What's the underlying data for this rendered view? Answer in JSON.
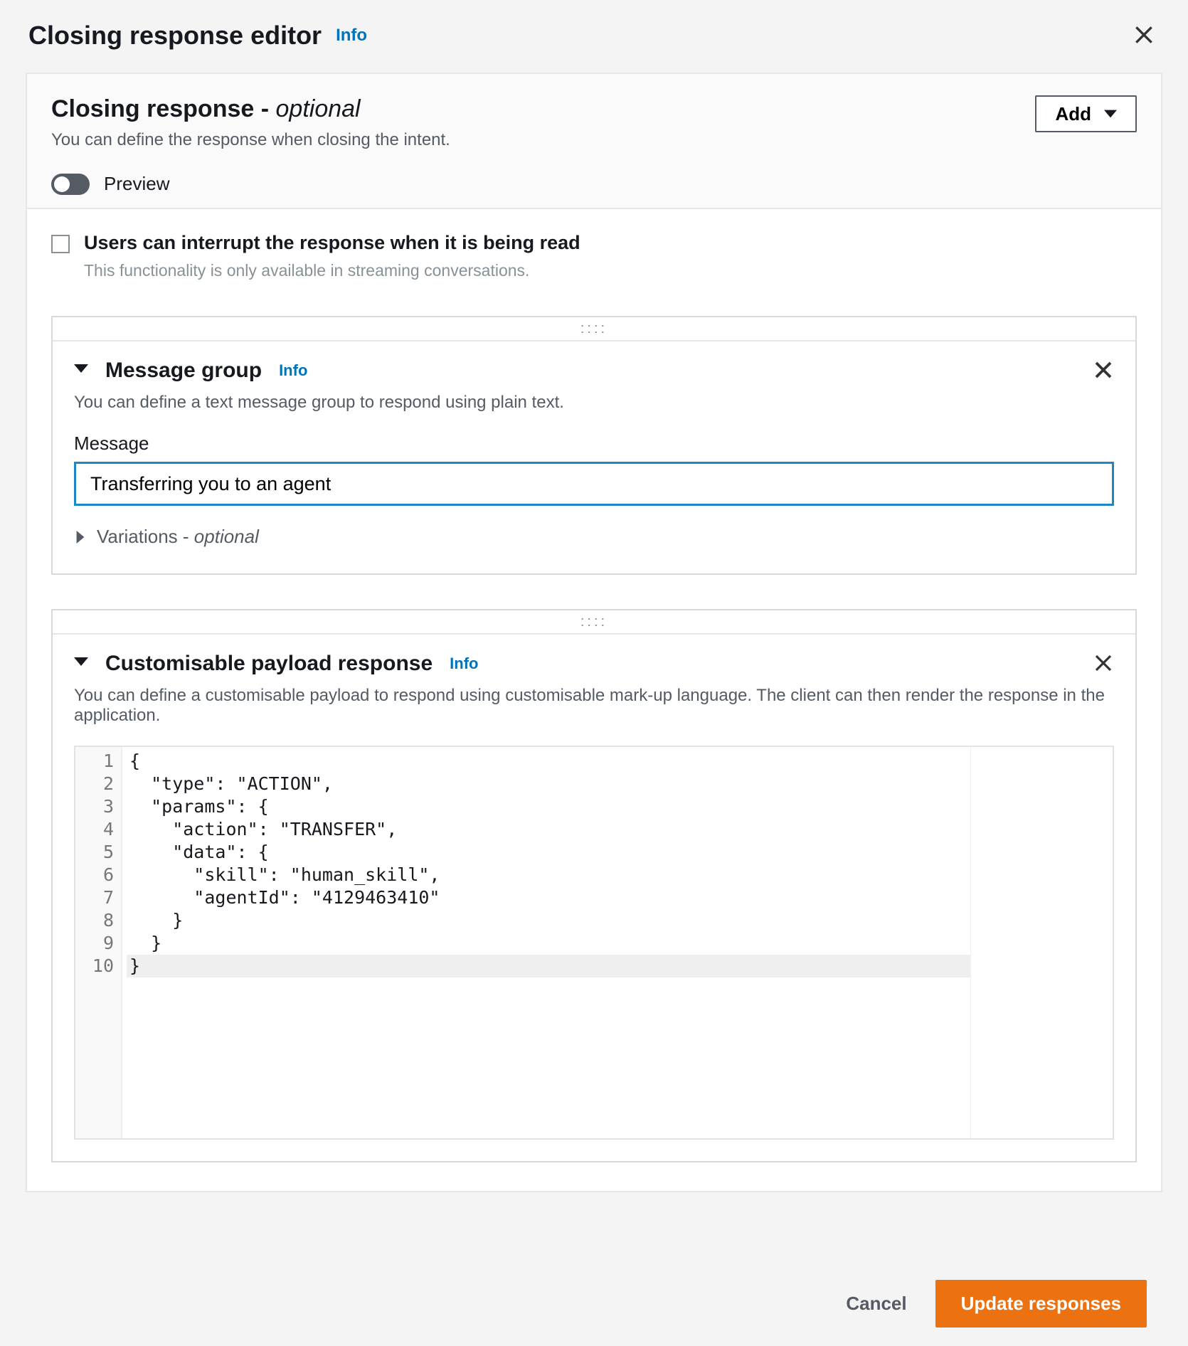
{
  "modal": {
    "title": "Closing response editor",
    "info_label": "Info"
  },
  "panel": {
    "title_main": "Closing response - ",
    "title_optional": "optional",
    "description": "You can define the response when closing the intent.",
    "add_button": "Add",
    "preview_label": "Preview"
  },
  "interrupt": {
    "label": "Users can interrupt the response when it is being read",
    "sub": "This functionality is only available in streaming conversations."
  },
  "message_group": {
    "title": "Message group",
    "info_label": "Info",
    "description": "You can define a text message group to respond using plain text.",
    "message_field_label": "Message",
    "message_value": "Transferring you to an agent",
    "variations_label_main": "Variations - ",
    "variations_label_optional": "optional",
    "grip": "::::"
  },
  "payload": {
    "title": "Customisable payload response",
    "info_label": "Info",
    "description": "You can define a customisable payload to respond using customisable mark-up language. The client can then render the response in the application.",
    "grip": "::::",
    "line_numbers": [
      "1",
      "2",
      "3",
      "4",
      "5",
      "6",
      "7",
      "8",
      "9",
      "10"
    ],
    "code_lines": [
      "{",
      "  \"type\": \"ACTION\",",
      "  \"params\": {",
      "    \"action\": \"TRANSFER\",",
      "    \"data\": {",
      "      \"skill\": \"human_skill\",",
      "      \"agentId\": \"4129463410\"",
      "    }",
      "  }",
      "}"
    ]
  },
  "footer": {
    "cancel": "Cancel",
    "update": "Update responses"
  }
}
